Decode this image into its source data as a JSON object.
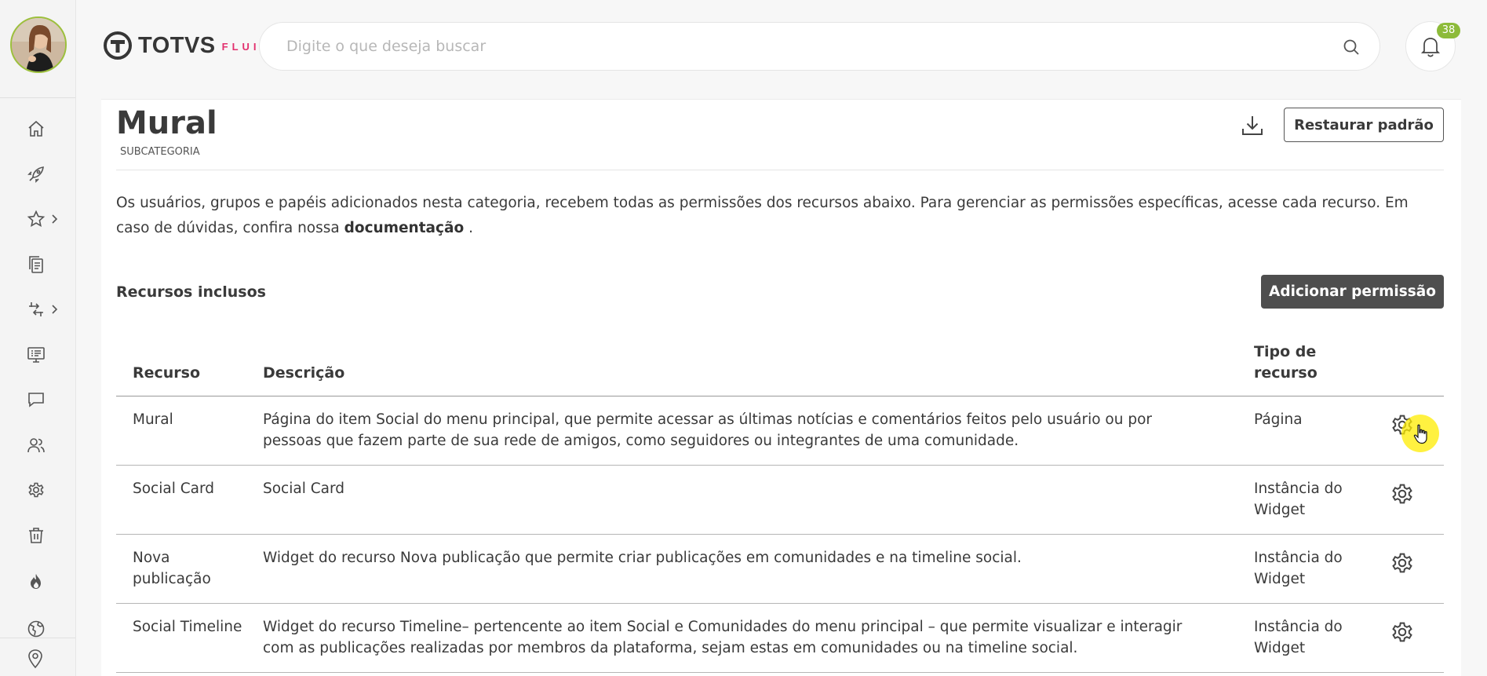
{
  "header": {
    "logo_text": "TOTVS",
    "logo_sub": "FLUIG",
    "search_placeholder": "Digite o que deseja buscar",
    "notifications_count": "38"
  },
  "sidebar": {
    "items": [
      {
        "name": "home",
        "icon": "home-icon"
      },
      {
        "name": "launch",
        "icon": "rocket-icon"
      },
      {
        "name": "favorites",
        "icon": "star-icon",
        "has_submenu": true
      },
      {
        "name": "documents",
        "icon": "documents-icon"
      },
      {
        "name": "processes",
        "icon": "process-icon",
        "has_submenu": true
      },
      {
        "name": "presentation",
        "icon": "monitor-icon"
      },
      {
        "name": "messages",
        "icon": "chat-icon"
      },
      {
        "name": "people",
        "icon": "users-icon"
      },
      {
        "name": "settings",
        "icon": "gear-icon"
      },
      {
        "name": "trash",
        "icon": "trash-icon"
      },
      {
        "name": "gamification",
        "icon": "flame-icon"
      },
      {
        "name": "globe",
        "icon": "globe-icon"
      }
    ],
    "bottom_icon": "location-pin-icon"
  },
  "page": {
    "title": "Mural",
    "subtitle": "SUBCATEGORIA",
    "restore_button": "Restaurar padrão",
    "description_text": "Os usuários, grupos e papéis adicionados nesta categoria, recebem todas as permissões dos recursos abaixo. Para gerenciar as permissões específicas, acesse cada recurso. Em caso de dúvidas, confira nossa ",
    "description_link": "documentação",
    "description_end": " .",
    "section_title": "Recursos inclusos",
    "add_permission_button": "Adicionar permissão"
  },
  "table": {
    "headers": {
      "recurso": "Recurso",
      "descricao": "Descrição",
      "tipo_line1": "Tipo de",
      "tipo_line2": "recurso"
    },
    "rows": [
      {
        "recurso": "Mural",
        "descricao": "Página do item Social do menu principal, que permite acessar as últimas notícias e comentários feitos pelo usuário ou por pessoas que fazem parte de sua rede de amigos, como seguidores ou integrantes de uma comunidade.",
        "tipo": "Página"
      },
      {
        "recurso": "Social Card",
        "descricao": "Social Card",
        "tipo": "Instância do Widget"
      },
      {
        "recurso": "Nova publicação",
        "descricao": "Widget do recurso Nova publicação que permite criar publicações em comunidades e na timeline social.",
        "tipo": "Instância do Widget"
      },
      {
        "recurso": "Social Timeline",
        "descricao": "Widget do recurso Timeline– pertencente ao item Social e Comunidades do menu principal – que permite visualizar e interagir com as publicações realizadas por membros da plataforma, sejam estas em comunidades ou na timeline social.",
        "tipo": "Instância do Widget"
      }
    ]
  },
  "colors": {
    "accent_green": "#8dbb3a",
    "brand_pink": "#e2306e",
    "dark_button": "#4e4e4e",
    "cursor_highlight": "#ffec00"
  }
}
